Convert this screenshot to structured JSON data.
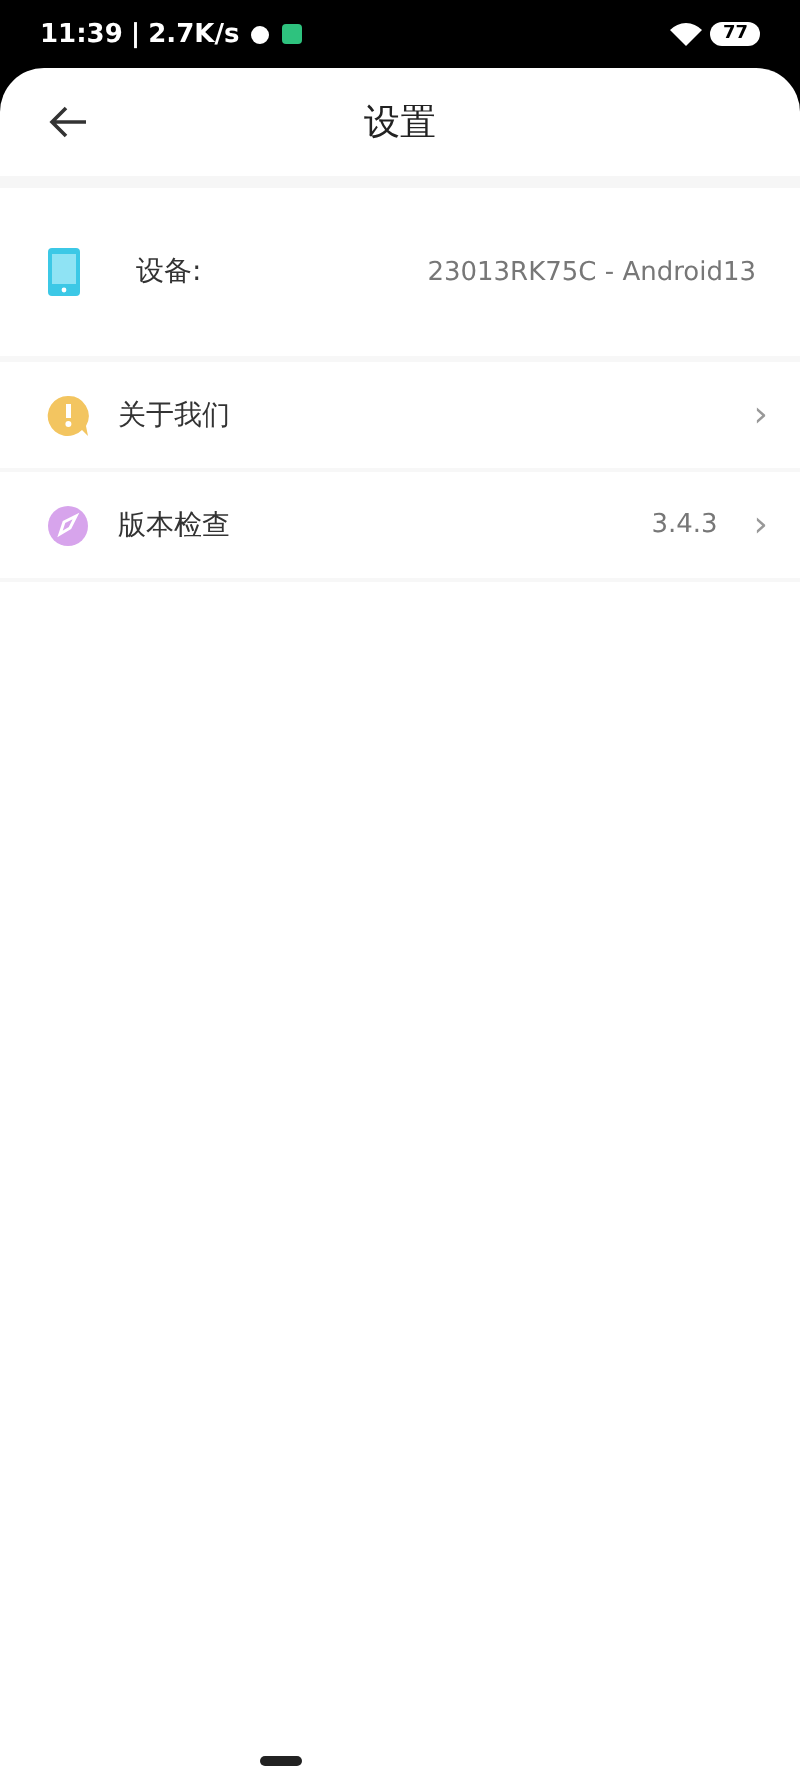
{
  "status_bar": {
    "time": "11:39",
    "separator": "|",
    "speed": "2.7K/s",
    "battery": "77"
  },
  "header": {
    "title": "设置"
  },
  "device": {
    "label": "设备:",
    "value": "23013RK75C - Android13"
  },
  "menu": [
    {
      "kind": "about",
      "label": "关于我们",
      "chevron": "›"
    },
    {
      "kind": "version",
      "label": "版本检查",
      "value": "3.4.3",
      "chevron": "›"
    }
  ]
}
